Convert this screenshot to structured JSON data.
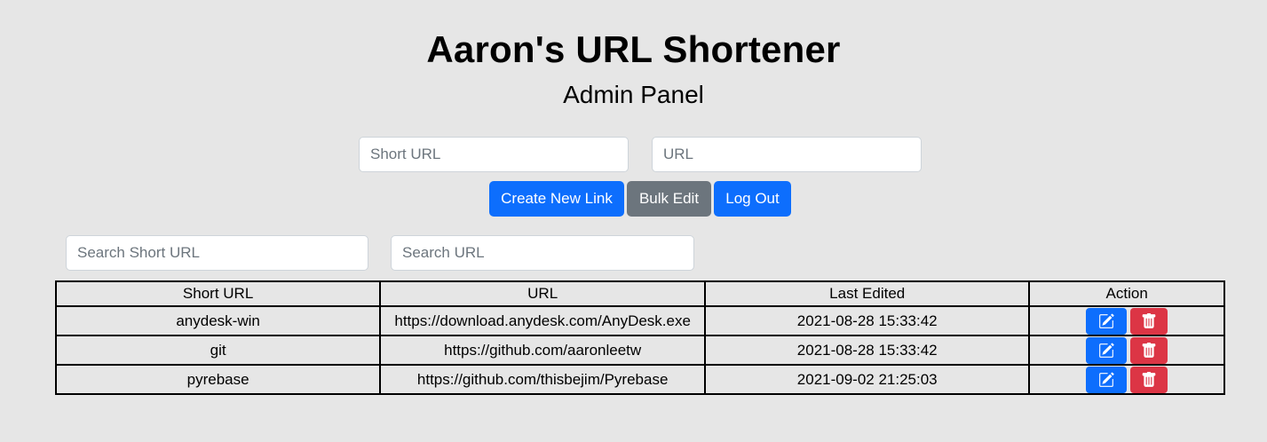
{
  "header": {
    "title": "Aaron's URL Shortener",
    "subtitle": "Admin Panel"
  },
  "create_form": {
    "short_url_placeholder": "Short URL",
    "url_placeholder": "URL"
  },
  "toolbar": {
    "create_label": "Create New Link",
    "bulk_edit_label": "Bulk Edit",
    "logout_label": "Log Out"
  },
  "search": {
    "short_url_placeholder": "Search Short URL",
    "url_placeholder": "Search URL"
  },
  "table": {
    "headers": [
      "Short URL",
      "URL",
      "Last Edited",
      "Action"
    ],
    "rows": [
      {
        "short": "anydesk-win",
        "url": "https://download.anydesk.com/AnyDesk.exe",
        "edited": "2021-08-28 15:33:42"
      },
      {
        "short": "git",
        "url": "https://github.com/aaronleetw",
        "edited": "2021-08-28 15:33:42"
      },
      {
        "short": "pyrebase",
        "url": "https://github.com/thisbejim/Pyrebase",
        "edited": "2021-09-02 21:25:03"
      }
    ]
  },
  "icons": {
    "edit": "pencil-square-icon",
    "delete": "trash-icon"
  },
  "colors": {
    "primary": "#0d6efd",
    "secondary": "#6c757d",
    "danger": "#dc3545",
    "background": "#e6e6e6"
  }
}
